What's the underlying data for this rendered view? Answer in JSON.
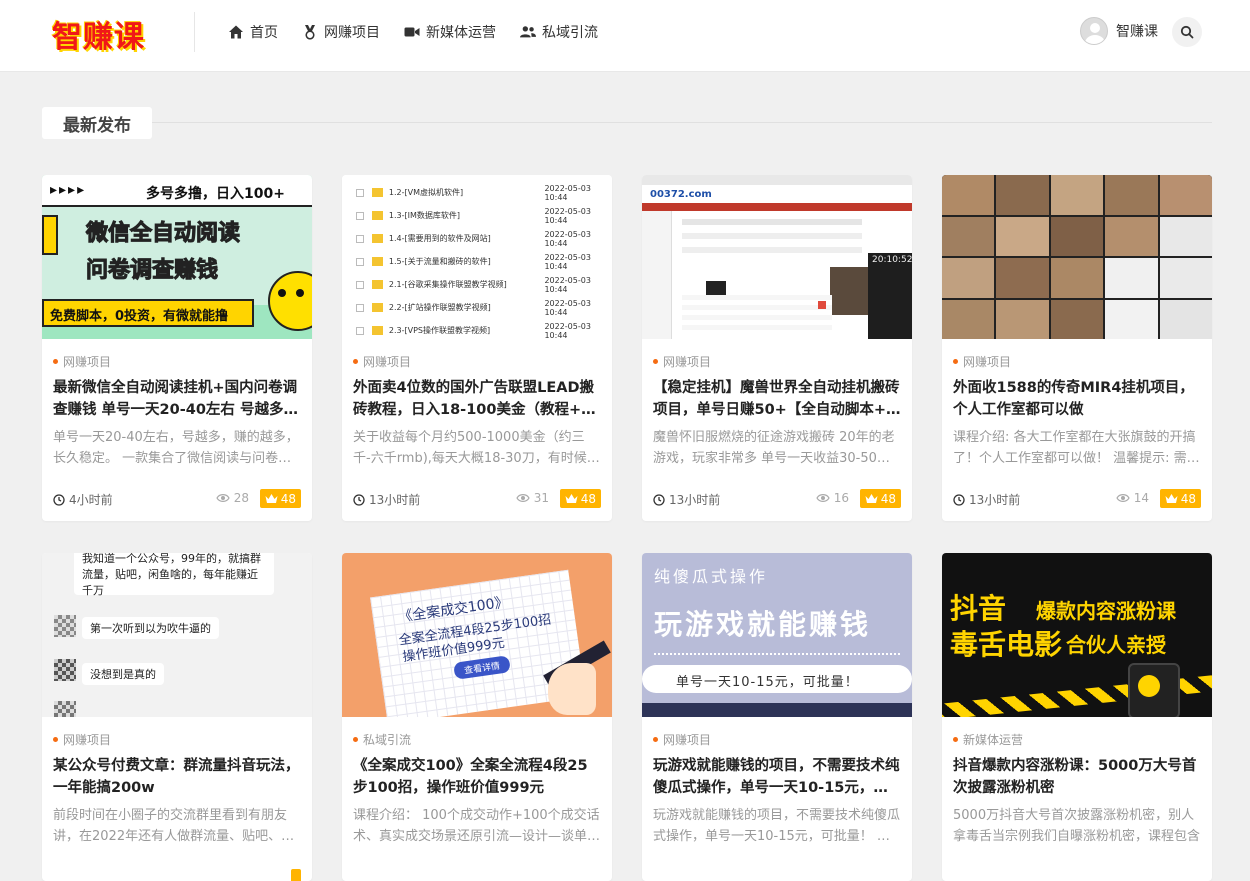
{
  "header": {
    "logo": "智赚课",
    "nav": [
      {
        "label": "首页",
        "icon": "home-icon"
      },
      {
        "label": "网赚项目",
        "icon": "medal-icon"
      },
      {
        "label": "新媒体运营",
        "icon": "video-camera-icon"
      },
      {
        "label": "私域引流",
        "icon": "users-icon"
      }
    ],
    "user_name": "智赚课",
    "colors": {
      "logo": "#f01818",
      "logo_shadow": "#ffd400"
    }
  },
  "section": {
    "title": "最新发布"
  },
  "cards": [
    {
      "category": "网赚项目",
      "title": "最新微信全自动阅读挂机+国内问卷调查赚钱 单号一天20-40左右 号越多赚的越多",
      "desc": "单号一天20-40左右，号越多，赚的越多，长久稳定。 一款集合了微信阅读与问卷调查的全自动挂机项目",
      "time": "4小时前",
      "views": "28",
      "price": "48",
      "thumb": {
        "line1": "▸▸▸▸",
        "line2": "多号多撸，日入100+",
        "line3": "微信全自动阅读",
        "line4": "问卷调查赚钱",
        "line5": "免费脚本，0投资，有微就能撸"
      }
    },
    {
      "category": "网赚项目",
      "title": "外面卖4位数的国外广告联盟LEAD搬砖教程，日入18-100美金（教程+工具）",
      "desc": "关于收益每个月约500-1000美金（约三千-六千rmb),每天大概18-30刀，有时候更多",
      "time": "13小时前",
      "views": "31",
      "price": "48",
      "thumb": {
        "rows": [
          {
            "name": "1.2-[VM虚拟机软件]",
            "date": "2022-05-03 10:44"
          },
          {
            "name": "1.3-[IM数据库软件]",
            "date": "2022-05-03 10:44"
          },
          {
            "name": "1.4-[需要用到的软件及网站]",
            "date": "2022-05-03 10:44"
          },
          {
            "name": "1.5-[关于流量和搬砖的软件]",
            "date": "2022-05-03 10:44"
          },
          {
            "name": "2.1-[谷歌采集操作联盟教学视频]",
            "date": "2022-05-03 10:44"
          },
          {
            "name": "2.2-[扩站操作联盟教学视频]",
            "date": "2022-05-03 10:44"
          },
          {
            "name": "2.3-[VPS操作联盟教学视频]",
            "date": "2022-05-03 10:44"
          }
        ]
      }
    },
    {
      "category": "网赚项目",
      "title": "【稳定挂机】魔兽世界全自动挂机搬砖项目，单号日赚50+【全自动脚本+详细教程】",
      "desc": "魔兽怀旧服燃烧的征途游戏搬砖 20年的老游戏，玩家非常多 单号一天收益30-50左右",
      "time": "13小时前",
      "views": "16",
      "price": "48",
      "thumb": {
        "logo": "00372.com",
        "clock": "20:10:52"
      }
    },
    {
      "category": "网赚项目",
      "title": "外面收1588的传奇MIR4挂机项目，个人工作室都可以做",
      "desc": "课程介绍: 各大工作室都在大张旗鼓的开搞了！个人工作室都可以做！ 温馨提示: 需要一定的资金",
      "time": "13小时前",
      "views": "14",
      "price": "48",
      "thumb": {}
    },
    {
      "category": "网赚项目",
      "title": "某公众号付费文章：群流量抖音玩法，一年能搞200w",
      "desc": "前段时间在小圈子的交流群里看到有朋友讲，在2022年还有人做群流量、贴吧、闲鱼",
      "time": "",
      "views": "",
      "price": "",
      "thumb": {
        "msg1": "我知道一个公众号，99年的，就搞群流量，贴吧，闲鱼啥的，每年能赚近千万",
        "msg2": "第一次听到以为吹牛逼的",
        "msg3": "没想到是真的"
      }
    },
    {
      "category": "私域引流",
      "title": "《全案成交100》全案全流程4段25步100招，操作班价值999元",
      "desc": "课程介绍： 100个成交动作+100个成交话术、真实成交场景还原引流—设计—谈单—成交",
      "time": "",
      "views": "",
      "price": "",
      "thumb": {
        "line1": "《全案成交100》",
        "line2": "全案全流程4段25步100招",
        "line3": "操作班价值999元",
        "btn": "查看详情"
      }
    },
    {
      "category": "网赚项目",
      "title": "玩游戏就能赚钱的项目，不需要技术纯傻瓜式操作，单号一天10-15元，可批量",
      "desc": "玩游戏就能赚钱的项目，不需要技术纯傻瓜式操作，单号一天10-15元，可批量！ 优点",
      "time": "",
      "views": "",
      "price": "",
      "thumb": {
        "line1": "纯傻瓜式操作",
        "line2": "玩游戏就能赚钱",
        "line3": "单号一天10-15元，可批量！"
      }
    },
    {
      "category": "新媒体运营",
      "title": "抖音爆款内容涨粉课：5000万大号首次披露涨粉机密",
      "desc": "5000万抖音大号首次披露涨粉机密，别人拿毒舌当宗例我们自曝涨粉机密，课程包含",
      "time": "",
      "views": "",
      "price": "",
      "thumb": {
        "line1": "抖音",
        "line2": "爆款内容涨粉课",
        "line3": "毒舌电影",
        "line4": "合伙人亲授"
      }
    }
  ]
}
